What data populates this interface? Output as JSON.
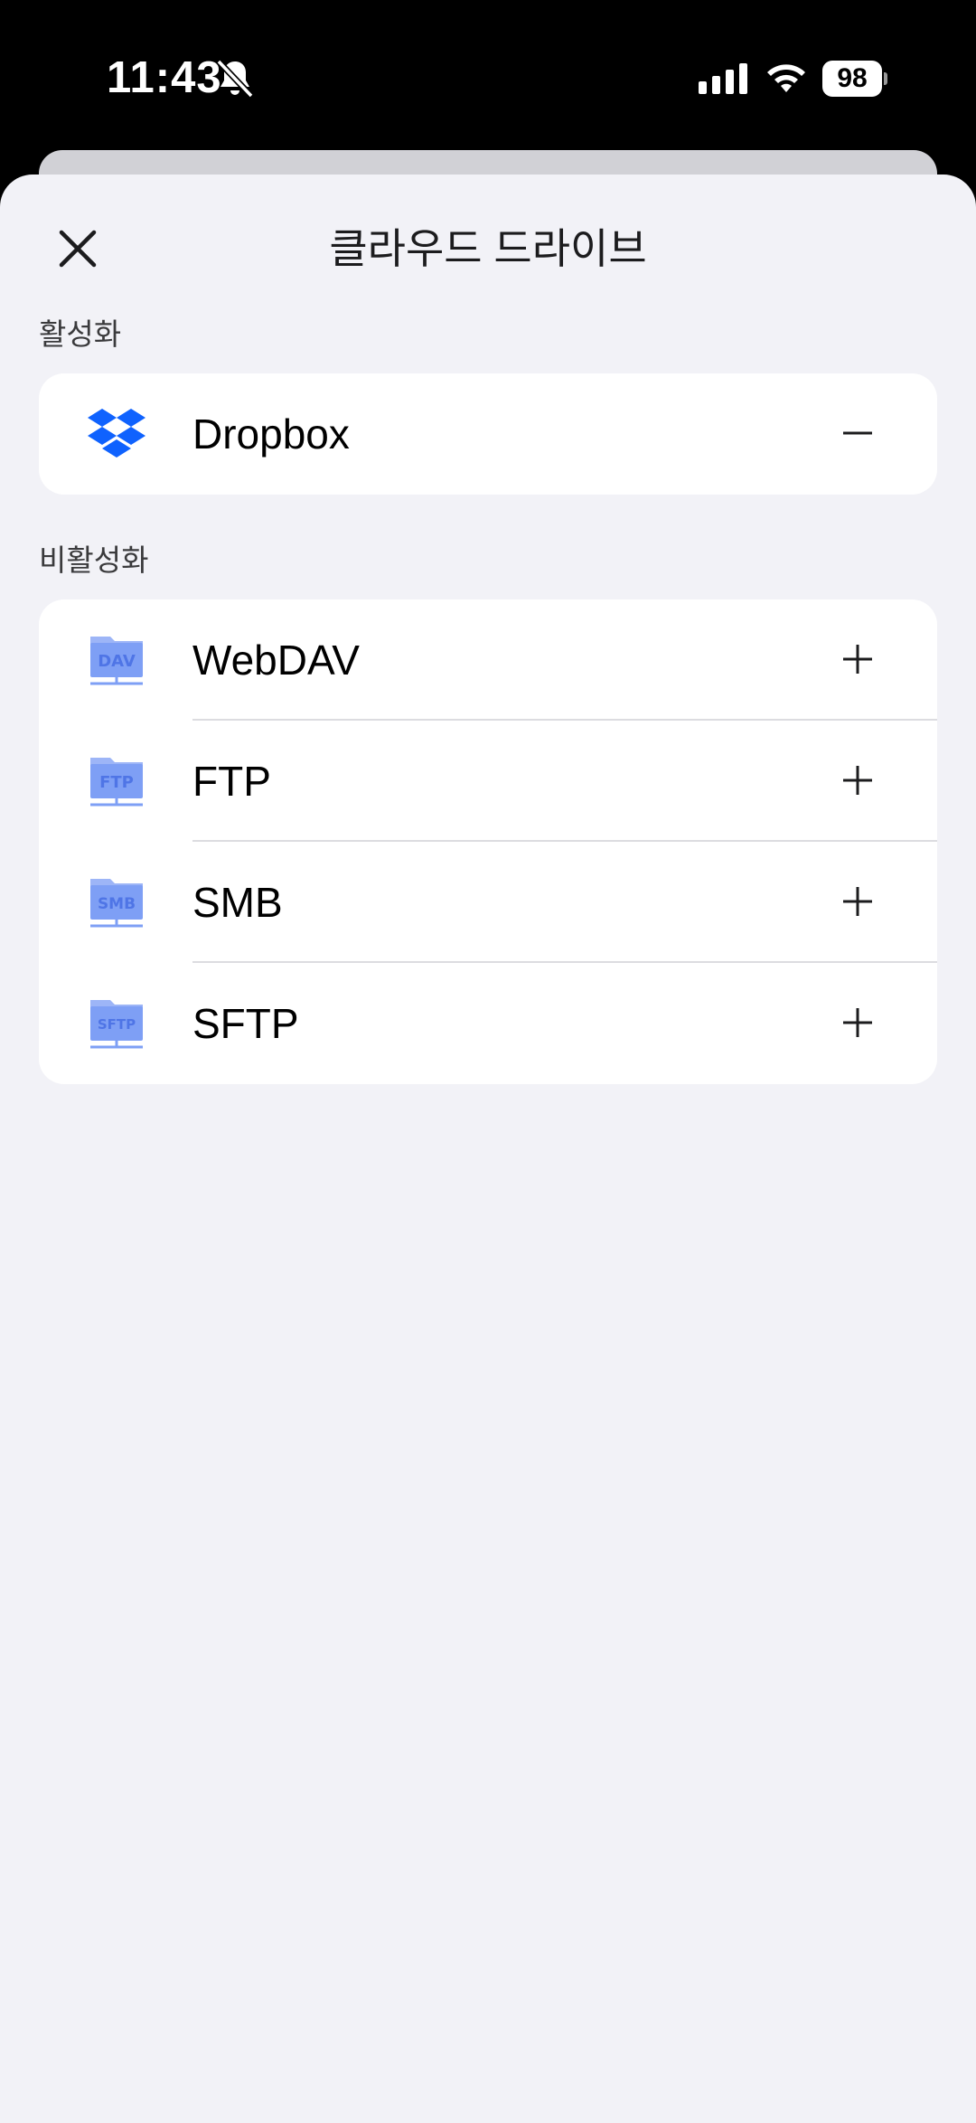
{
  "status_bar": {
    "time": "11:43",
    "battery": "98",
    "icons": [
      "bell-slash-icon",
      "cellular-signal-icon",
      "wifi-icon",
      "battery-icon"
    ]
  },
  "sheet": {
    "title": "클라우드 드라이브",
    "close_icon": "close-icon"
  },
  "sections": {
    "active": {
      "label": "활성화",
      "items": [
        {
          "label": "Dropbox",
          "icon": "dropbox-icon",
          "action": "remove"
        }
      ]
    },
    "inactive": {
      "label": "비활성화",
      "items": [
        {
          "label": "WebDAV",
          "icon": "webdav-folder-icon",
          "badge": "DAV",
          "action": "add"
        },
        {
          "label": "FTP",
          "icon": "ftp-folder-icon",
          "badge": "FTP",
          "action": "add"
        },
        {
          "label": "SMB",
          "icon": "smb-folder-icon",
          "badge": "SMB",
          "action": "add"
        },
        {
          "label": "SFTP",
          "icon": "sftp-folder-icon",
          "badge": "SFTP",
          "action": "add"
        }
      ]
    }
  },
  "colors": {
    "sheet_bg": "#f2f2f7",
    "dropbox_blue": "#0f62fe",
    "folder_blue": "#7e9ff5"
  }
}
